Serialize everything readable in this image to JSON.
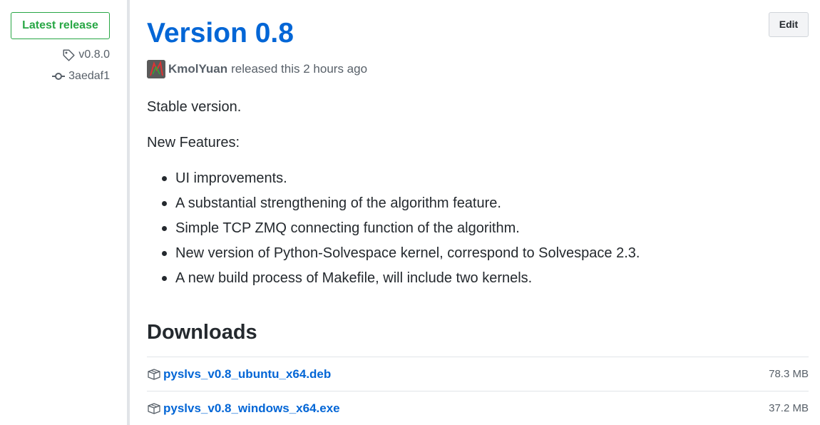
{
  "sidebar": {
    "badge_label": "Latest release",
    "tag": "v0.8.0",
    "commit": "3aedaf1"
  },
  "release": {
    "title": "Version 0.8",
    "edit_label": "Edit",
    "author": "KmolYuan",
    "released_text": "released this 2 hours ago",
    "intro": "Stable version.",
    "features_heading": "New Features:",
    "features": [
      "UI improvements.",
      "A substantial strengthening of the algorithm feature.",
      "Simple TCP ZMQ connecting function of the algorithm.",
      "New version of Python-Solvespace kernel, correspond to Solvespace 2.3.",
      "A new build process of Makefile, will include two kernels."
    ]
  },
  "downloads": {
    "heading": "Downloads",
    "items": [
      {
        "name": "pyslvs_v0.8_ubuntu_x64.deb",
        "size": "78.3 MB",
        "icon": "package-icon"
      },
      {
        "name": "pyslvs_v0.8_windows_x64.exe",
        "size": "37.2 MB",
        "icon": "package-icon"
      }
    ]
  },
  "colors": {
    "accent": "#0366d6",
    "success": "#28a745",
    "muted": "#586069",
    "border": "#e1e4e8"
  }
}
